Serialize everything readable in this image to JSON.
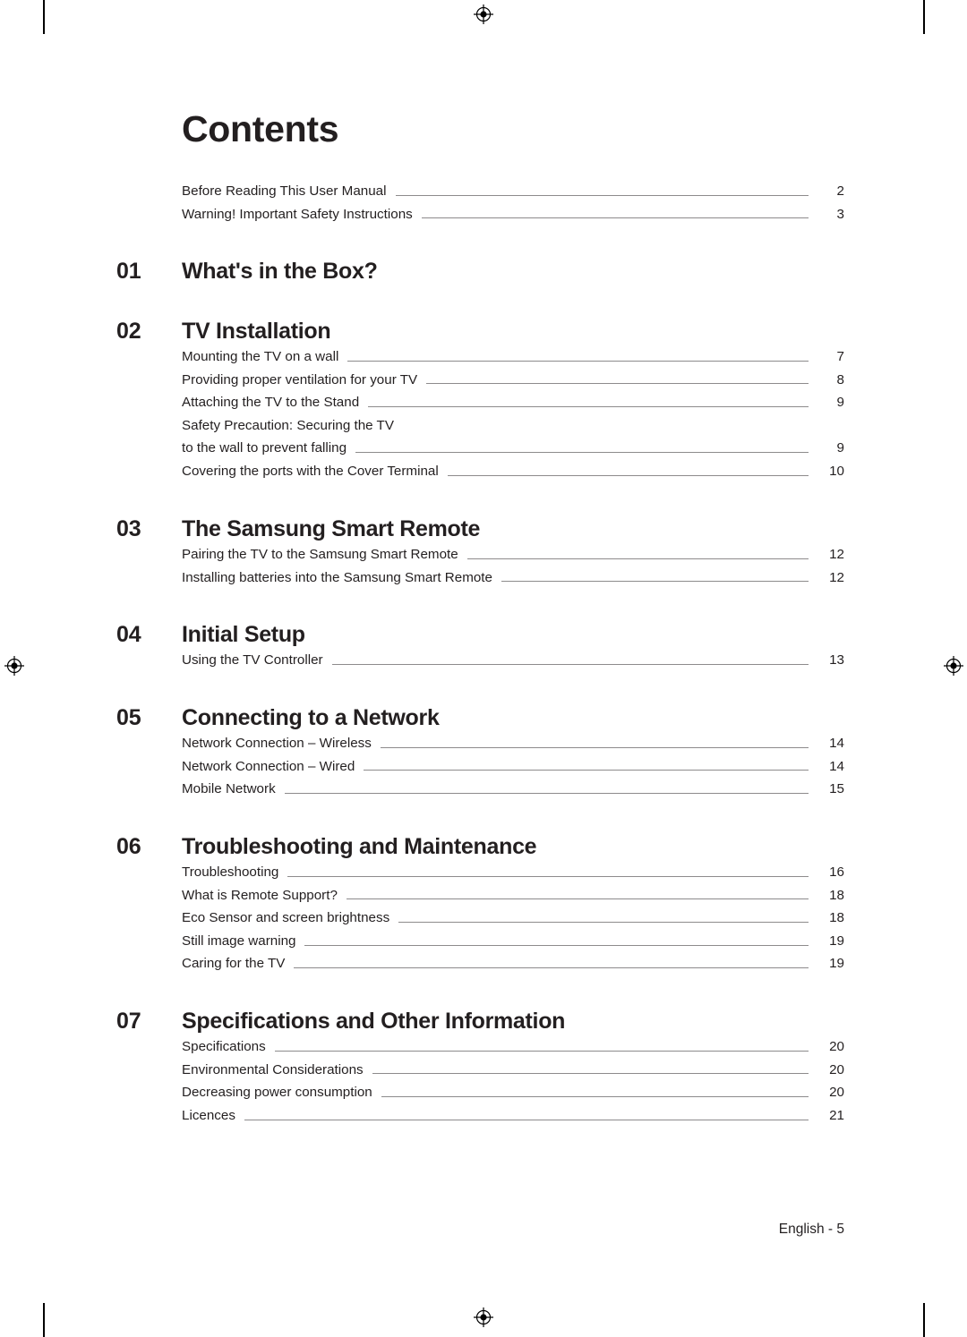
{
  "document": {
    "title": "Contents",
    "footer": "English - 5"
  },
  "frontmatter": [
    {
      "label": "Before Reading This User Manual",
      "page": "2",
      "leader": true
    },
    {
      "label": "Warning! Important Safety Instructions",
      "page": "3",
      "leader": true
    }
  ],
  "chapters": [
    {
      "number": "01",
      "title": "What's in the Box?",
      "entries": []
    },
    {
      "number": "02",
      "title": "TV Installation",
      "entries": [
        {
          "label": "Mounting the TV on a wall",
          "page": "7",
          "leader": true
        },
        {
          "label": "Providing proper ventilation for your TV",
          "page": "8",
          "leader": true
        },
        {
          "label": "Attaching the TV to the Stand",
          "page": "9",
          "leader": true
        },
        {
          "label": "Safety Precaution: Securing the TV",
          "page": "",
          "leader": false
        },
        {
          "label": "to the wall to prevent falling",
          "page": "9",
          "leader": true
        },
        {
          "label": "Covering the ports with the Cover Terminal",
          "page": "10",
          "leader": true
        }
      ]
    },
    {
      "number": "03",
      "title": "The Samsung Smart Remote",
      "entries": [
        {
          "label": "Pairing the TV to the Samsung Smart Remote",
          "page": "12",
          "leader": true
        },
        {
          "label": "Installing batteries into the Samsung Smart Remote",
          "page": "12",
          "leader": true
        }
      ]
    },
    {
      "number": "04",
      "title": "Initial Setup",
      "entries": [
        {
          "label": "Using the TV Controller",
          "page": "13",
          "leader": true
        }
      ]
    },
    {
      "number": "05",
      "title": "Connecting to a Network",
      "entries": [
        {
          "label": "Network Connection – Wireless",
          "page": "14",
          "leader": true
        },
        {
          "label": "Network Connection – Wired",
          "page": "14",
          "leader": true
        },
        {
          "label": "Mobile Network",
          "page": "15",
          "leader": true
        }
      ]
    },
    {
      "number": "06",
      "title": "Troubleshooting and Maintenance",
      "entries": [
        {
          "label": "Troubleshooting",
          "page": "16",
          "leader": true
        },
        {
          "label": "What is Remote Support?",
          "page": "18",
          "leader": true
        },
        {
          "label": "Eco Sensor and screen brightness",
          "page": "18",
          "leader": true
        },
        {
          "label": "Still image warning",
          "page": "19",
          "leader": true
        },
        {
          "label": "Caring for the TV",
          "page": "19",
          "leader": true
        }
      ]
    },
    {
      "number": "07",
      "title": "Specifications and Other Information",
      "entries": [
        {
          "label": "Specifications",
          "page": "20",
          "leader": true
        },
        {
          "label": "Environmental Considerations",
          "page": "20",
          "leader": true
        },
        {
          "label": "Decreasing power consumption",
          "page": "20",
          "leader": true
        },
        {
          "label": "Licences",
          "page": "21",
          "leader": true
        }
      ]
    }
  ],
  "print_marks": {
    "registration": "registration-target",
    "crop": "crop-mark"
  }
}
